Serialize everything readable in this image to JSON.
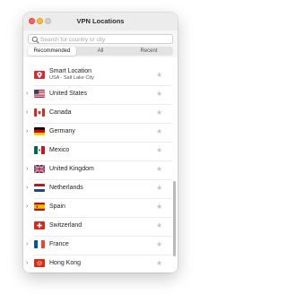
{
  "window": {
    "title": "VPN Locations"
  },
  "search": {
    "placeholder": "Search for country or city"
  },
  "tabs": [
    {
      "label": "Recommended",
      "active": true
    },
    {
      "label": "All",
      "active": false
    },
    {
      "label": "Recent",
      "active": false
    }
  ],
  "locations": [
    {
      "name": "Smart Location",
      "sub": "USA - Salt Lake City",
      "flag": "smart-location",
      "expandable": false
    },
    {
      "name": "United States",
      "flag": "us",
      "expandable": true
    },
    {
      "name": "Canada",
      "flag": "ca",
      "expandable": true
    },
    {
      "name": "Germany",
      "flag": "de",
      "expandable": true
    },
    {
      "name": "Mexico",
      "flag": "mx",
      "expandable": false
    },
    {
      "name": "United Kingdom",
      "flag": "gb",
      "expandable": true
    },
    {
      "name": "Netherlands",
      "flag": "nl",
      "expandable": true
    },
    {
      "name": "Spain",
      "flag": "es",
      "expandable": true
    },
    {
      "name": "Switzerland",
      "flag": "ch",
      "expandable": false
    },
    {
      "name": "France",
      "flag": "fr",
      "expandable": true
    },
    {
      "name": "Hong Kong",
      "flag": "hk",
      "expandable": true
    }
  ],
  "colors": {
    "accent": "#d22b36"
  }
}
